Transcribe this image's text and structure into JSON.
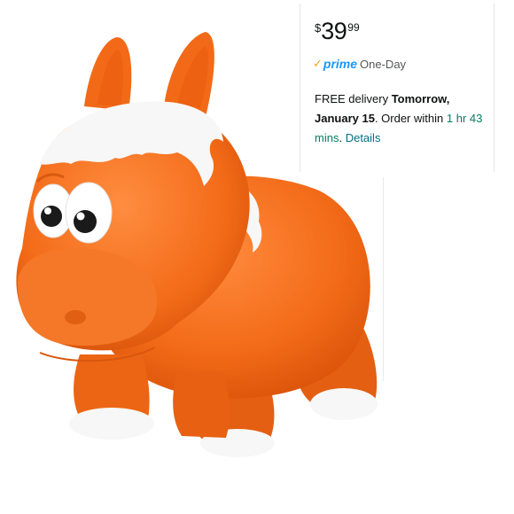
{
  "offer": {
    "price_symbol": "$",
    "price_whole": "39",
    "price_fraction": "99",
    "prime_check_icon": "checkmark-icon",
    "prime_label": "prime",
    "prime_speed": "One-Day",
    "delivery_prefix": "FREE delivery",
    "delivery_day": "Tomorrow,",
    "delivery_date": "January 15",
    "order_within_prefix": ". Order within",
    "countdown_hours": "1 hr",
    "countdown_minutes": "43 mins",
    "details_link": "Details",
    "end_period": "."
  },
  "colors": {
    "toy_orange": "#f26f1f",
    "toy_white": "#ffffff",
    "prime_blue": "#1a98ff",
    "prime_check": "#f7a21b",
    "countdown_green": "#067d62",
    "link_teal": "#007185"
  }
}
